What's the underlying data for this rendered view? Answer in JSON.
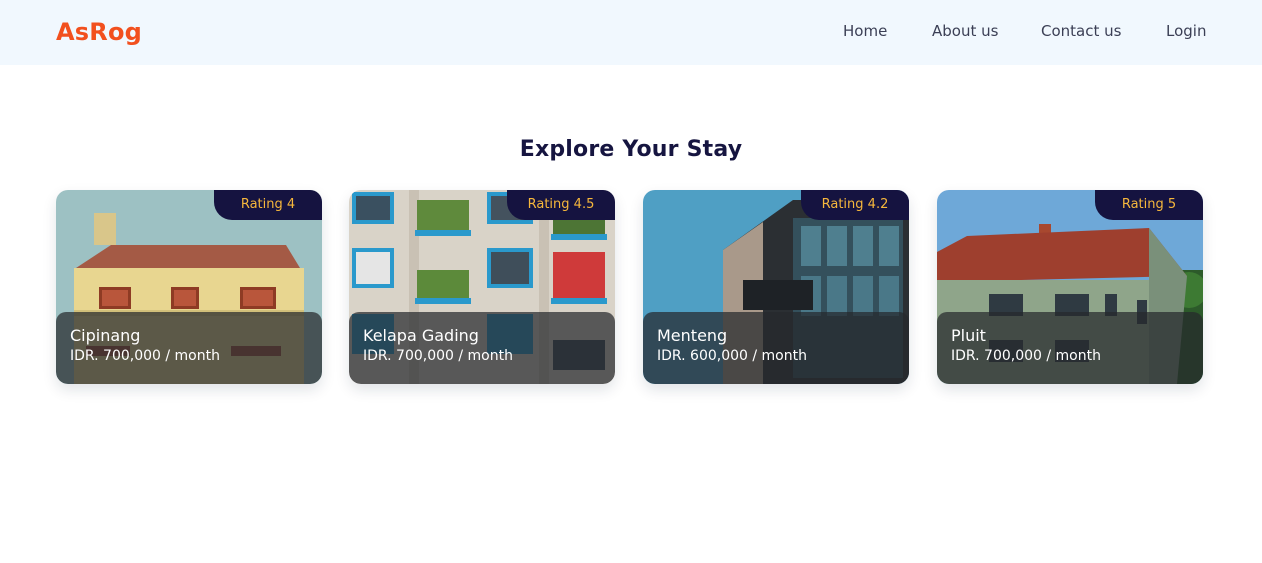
{
  "header": {
    "logo": "AsRog",
    "nav": [
      "Home",
      "About us",
      "Contact us",
      "Login"
    ]
  },
  "main": {
    "title": "Explore Your Stay",
    "listings": [
      {
        "rating": "Rating 4",
        "name": "Cipinang",
        "price": "IDR. 700,000 / month"
      },
      {
        "rating": "Rating 4.5",
        "name": "Kelapa Gading",
        "price": "IDR. 700,000 / month"
      },
      {
        "rating": "Rating 4.2",
        "name": "Menteng",
        "price": "IDR. 600,000 / month"
      },
      {
        "rating": "Rating 5",
        "name": "Pluit",
        "price": "IDR. 700,000 / month"
      }
    ]
  },
  "colors": {
    "logo": "#f2501e",
    "navbar_bg": "#f1f8fe",
    "rating_bg": "#151340",
    "rating_text": "#f6b73c",
    "title": "#161540"
  }
}
